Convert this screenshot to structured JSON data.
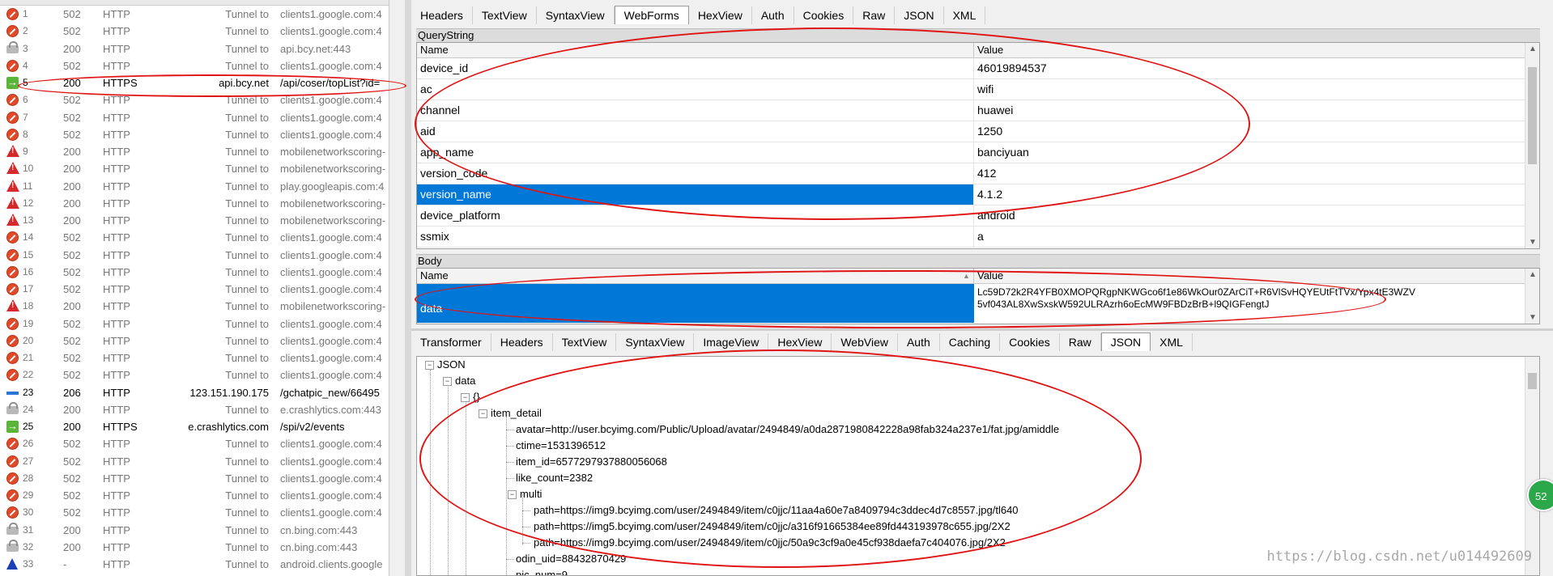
{
  "sessions": [
    {
      "num": "1",
      "result": "502",
      "protocol": "HTTP",
      "host": "Tunnel to",
      "url": "clients1.google.com:4",
      "icon": "stop-icon"
    },
    {
      "num": "2",
      "result": "502",
      "protocol": "HTTP",
      "host": "Tunnel to",
      "url": "clients1.google.com:4",
      "icon": "stop-icon"
    },
    {
      "num": "3",
      "result": "200",
      "protocol": "HTTP",
      "host": "Tunnel to",
      "url": "api.bcy.net:443",
      "icon": "lock-icon"
    },
    {
      "num": "4",
      "result": "502",
      "protocol": "HTTP",
      "host": "Tunnel to",
      "url": "clients1.google.com:4",
      "icon": "stop-icon"
    },
    {
      "num": "5",
      "result": "200",
      "protocol": "HTTPS",
      "host": "api.bcy.net",
      "url": "/api/coser/topList?id=",
      "icon": "arrow-icon",
      "https": true
    },
    {
      "num": "6",
      "result": "502",
      "protocol": "HTTP",
      "host": "Tunnel to",
      "url": "clients1.google.com:4",
      "icon": "stop-icon"
    },
    {
      "num": "7",
      "result": "502",
      "protocol": "HTTP",
      "host": "Tunnel to",
      "url": "clients1.google.com:4",
      "icon": "stop-icon"
    },
    {
      "num": "8",
      "result": "502",
      "protocol": "HTTP",
      "host": "Tunnel to",
      "url": "clients1.google.com:4",
      "icon": "stop-icon"
    },
    {
      "num": "9",
      "result": "200",
      "protocol": "HTTP",
      "host": "Tunnel to",
      "url": "mobilenetworkscoring-",
      "icon": "warning-icon"
    },
    {
      "num": "10",
      "result": "200",
      "protocol": "HTTP",
      "host": "Tunnel to",
      "url": "mobilenetworkscoring-",
      "icon": "warning-icon"
    },
    {
      "num": "11",
      "result": "200",
      "protocol": "HTTP",
      "host": "Tunnel to",
      "url": "play.googleapis.com:4",
      "icon": "warning-icon"
    },
    {
      "num": "12",
      "result": "200",
      "protocol": "HTTP",
      "host": "Tunnel to",
      "url": "mobilenetworkscoring-",
      "icon": "warning-icon"
    },
    {
      "num": "13",
      "result": "200",
      "protocol": "HTTP",
      "host": "Tunnel to",
      "url": "mobilenetworkscoring-",
      "icon": "warning-icon"
    },
    {
      "num": "14",
      "result": "502",
      "protocol": "HTTP",
      "host": "Tunnel to",
      "url": "clients1.google.com:4",
      "icon": "stop-icon"
    },
    {
      "num": "15",
      "result": "502",
      "protocol": "HTTP",
      "host": "Tunnel to",
      "url": "clients1.google.com:4",
      "icon": "stop-icon"
    },
    {
      "num": "16",
      "result": "502",
      "protocol": "HTTP",
      "host": "Tunnel to",
      "url": "clients1.google.com:4",
      "icon": "stop-icon"
    },
    {
      "num": "17",
      "result": "502",
      "protocol": "HTTP",
      "host": "Tunnel to",
      "url": "clients1.google.com:4",
      "icon": "stop-icon"
    },
    {
      "num": "18",
      "result": "200",
      "protocol": "HTTP",
      "host": "Tunnel to",
      "url": "mobilenetworkscoring-",
      "icon": "warning-icon"
    },
    {
      "num": "19",
      "result": "502",
      "protocol": "HTTP",
      "host": "Tunnel to",
      "url": "clients1.google.com:4",
      "icon": "stop-icon"
    },
    {
      "num": "20",
      "result": "502",
      "protocol": "HTTP",
      "host": "Tunnel to",
      "url": "clients1.google.com:4",
      "icon": "stop-icon"
    },
    {
      "num": "21",
      "result": "502",
      "protocol": "HTTP",
      "host": "Tunnel to",
      "url": "clients1.google.com:4",
      "icon": "stop-icon"
    },
    {
      "num": "22",
      "result": "502",
      "protocol": "HTTP",
      "host": "Tunnel to",
      "url": "clients1.google.com:4",
      "icon": "stop-icon"
    },
    {
      "num": "23",
      "result": "206",
      "protocol": "HTTP",
      "host": "123.151.190.175",
      "url": "/gchatpic_new/66495",
      "icon": "partial-icon",
      "https": true
    },
    {
      "num": "24",
      "result": "200",
      "protocol": "HTTP",
      "host": "Tunnel to",
      "url": "e.crashlytics.com:443",
      "icon": "lock-icon"
    },
    {
      "num": "25",
      "result": "200",
      "protocol": "HTTPS",
      "host": "e.crashlytics.com",
      "url": "/spi/v2/events",
      "icon": "arrow-icon",
      "https": true
    },
    {
      "num": "26",
      "result": "502",
      "protocol": "HTTP",
      "host": "Tunnel to",
      "url": "clients1.google.com:4",
      "icon": "stop-icon"
    },
    {
      "num": "27",
      "result": "502",
      "protocol": "HTTP",
      "host": "Tunnel to",
      "url": "clients1.google.com:4",
      "icon": "stop-icon"
    },
    {
      "num": "28",
      "result": "502",
      "protocol": "HTTP",
      "host": "Tunnel to",
      "url": "clients1.google.com:4",
      "icon": "stop-icon"
    },
    {
      "num": "29",
      "result": "502",
      "protocol": "HTTP",
      "host": "Tunnel to",
      "url": "clients1.google.com:4",
      "icon": "stop-icon"
    },
    {
      "num": "30",
      "result": "502",
      "protocol": "HTTP",
      "host": "Tunnel to",
      "url": "clients1.google.com:4",
      "icon": "stop-icon"
    },
    {
      "num": "31",
      "result": "200",
      "protocol": "HTTP",
      "host": "Tunnel to",
      "url": "cn.bing.com:443",
      "icon": "lock-icon"
    },
    {
      "num": "32",
      "result": "200",
      "protocol": "HTTP",
      "host": "Tunnel to",
      "url": "cn.bing.com:443",
      "icon": "lock-icon"
    },
    {
      "num": "33",
      "result": "-",
      "protocol": "HTTP",
      "host": "Tunnel to",
      "url": "android.clients.google",
      "icon": "upload-icon"
    }
  ],
  "request_tabs": [
    "Headers",
    "TextView",
    "SyntaxView",
    "WebForms",
    "HexView",
    "Auth",
    "Cookies",
    "Raw",
    "JSON",
    "XML"
  ],
  "request_active_tab": "WebForms",
  "querystring": {
    "label": "QueryString",
    "col_name": "Name",
    "col_value": "Value",
    "rows": [
      {
        "name": "device_id",
        "value": "46019894537"
      },
      {
        "name": "ac",
        "value": "wifi"
      },
      {
        "name": "channel",
        "value": "huawei"
      },
      {
        "name": "aid",
        "value": "1250"
      },
      {
        "name": "app_name",
        "value": "banciyuan"
      },
      {
        "name": "version_code",
        "value": "412"
      },
      {
        "name": "version_name",
        "value": "4.1.2",
        "selected": true
      },
      {
        "name": "device_platform",
        "value": "android"
      },
      {
        "name": "ssmix",
        "value": "a"
      }
    ]
  },
  "body": {
    "label": "Body",
    "col_name": "Name",
    "col_value": "Value",
    "row_name": "data",
    "row_value_1": "Lc59D72k2R4YFB0XMOPQRgpNKWGco6f1e86WkOur0ZArCiT+R6VlSvHQYEUtFtTVx/Ypx4tE3WZV",
    "row_value_2": "5vf043AL8XwSxskW592ULRAzrh6oEcMW9FBDzBrB+l9QIGFengtJ"
  },
  "response_tabs": [
    "Transformer",
    "Headers",
    "TextView",
    "SyntaxView",
    "ImageView",
    "HexView",
    "WebView",
    "Auth",
    "Caching",
    "Cookies",
    "Raw",
    "JSON",
    "XML"
  ],
  "response_active_tab": "JSON",
  "json_tree": {
    "root": "JSON",
    "data": "data",
    "arr": "{}",
    "item_detail": "item_detail",
    "avatar": "avatar=http://user.bcyimg.com/Public/Upload/avatar/2494849/a0da2871980842228a98fab324a237e1/fat.jpg/amiddle",
    "ctime": "ctime=1531396512",
    "item_id": "item_id=6577297937880056068",
    "like_count": "like_count=2382",
    "multi": "multi",
    "path1": "path=https://img9.bcyimg.com/user/2494849/item/c0jjc/11aa4a60e7a8409794c3ddec4d7c8557.jpg/tl640",
    "path2": "path=https://img5.bcyimg.com/user/2494849/item/c0jjc/a316f91665384ee89fd443193978c655.jpg/2X2",
    "path3": "path=https://img9.bcyimg.com/user/2494849/item/c0jjc/50a9c3cf9a0e45cf938daefa7c404076.jpg/2X2",
    "odin_uid": "odin_uid=88432870429",
    "pic_num": "pic_num=9"
  },
  "watermark": "https://blog.csdn.net/u014492609",
  "badge": "52",
  "colors": {
    "annotation": "#e01414",
    "selection": "#0078d7"
  }
}
